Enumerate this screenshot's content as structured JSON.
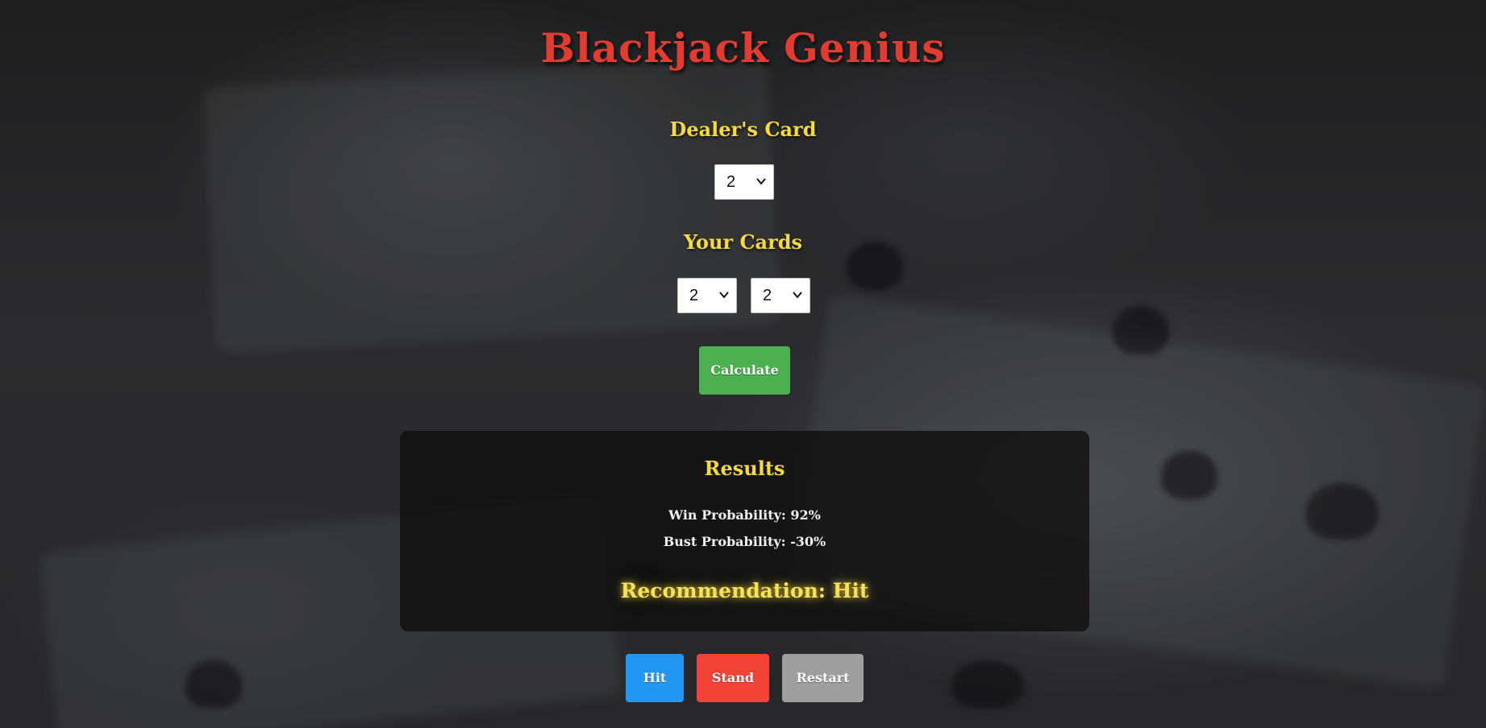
{
  "app": {
    "title": "Blackjack Genius"
  },
  "dealer": {
    "label": "Dealer's Card",
    "selected": "2"
  },
  "player": {
    "label": "Your Cards",
    "cards": [
      "2",
      "2"
    ]
  },
  "actions": {
    "calculate_label": "Calculate",
    "hit_label": "Hit",
    "stand_label": "Stand",
    "restart_label": "Restart"
  },
  "results": {
    "title": "Results",
    "win_text": "Win Probability: 92%",
    "bust_text": "Bust Probability: -30%",
    "recommendation_text": "Recommendation: Hit"
  },
  "colors": {
    "title": "#e23b2f",
    "label": "#f7d93a",
    "calculate": "#4caf50",
    "hit": "#2196f3",
    "stand": "#f44336",
    "restart": "#9e9e9e"
  },
  "icons": {
    "select_arrow": "chevron-down-icon"
  }
}
